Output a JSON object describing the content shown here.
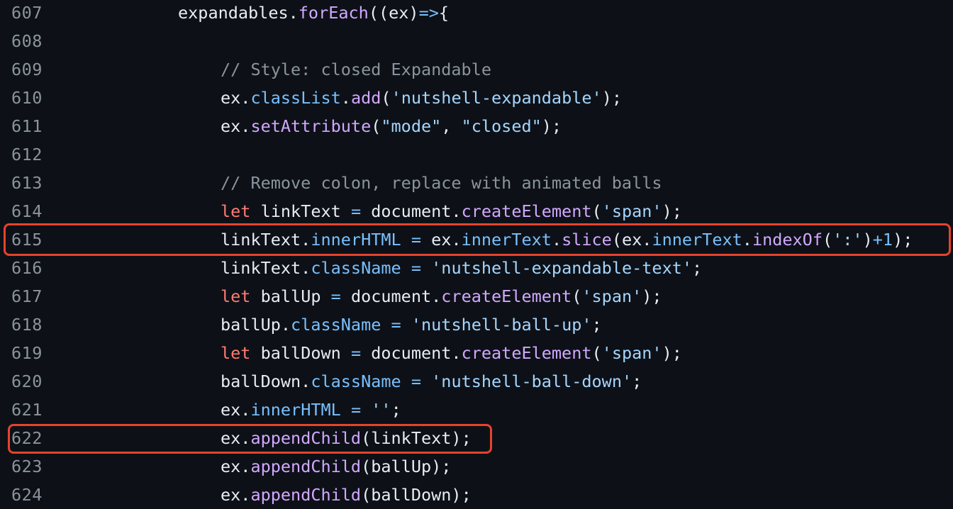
{
  "editor": {
    "lines": [
      {
        "number": "607",
        "indent": 1,
        "tokens": [
          {
            "t": "plain",
            "v": "expandables."
          },
          {
            "t": "fn",
            "v": "forEach"
          },
          {
            "t": "plain",
            "v": "((ex)"
          },
          {
            "t": "op",
            "v": "=>"
          },
          {
            "t": "plain",
            "v": "{"
          }
        ]
      },
      {
        "number": "608",
        "indent": 2,
        "tokens": []
      },
      {
        "number": "609",
        "indent": 2,
        "tokens": [
          {
            "t": "comment",
            "v": "// Style: closed Expandable"
          }
        ]
      },
      {
        "number": "610",
        "indent": 2,
        "tokens": [
          {
            "t": "plain",
            "v": "ex."
          },
          {
            "t": "prop",
            "v": "classList"
          },
          {
            "t": "plain",
            "v": "."
          },
          {
            "t": "fn",
            "v": "add"
          },
          {
            "t": "plain",
            "v": "("
          },
          {
            "t": "str",
            "v": "'nutshell-expandable'"
          },
          {
            "t": "plain",
            "v": ");"
          }
        ]
      },
      {
        "number": "611",
        "indent": 2,
        "tokens": [
          {
            "t": "plain",
            "v": "ex."
          },
          {
            "t": "fn",
            "v": "setAttribute"
          },
          {
            "t": "plain",
            "v": "("
          },
          {
            "t": "str",
            "v": "\"mode\""
          },
          {
            "t": "plain",
            "v": ", "
          },
          {
            "t": "str",
            "v": "\"closed\""
          },
          {
            "t": "plain",
            "v": ");"
          }
        ]
      },
      {
        "number": "612",
        "indent": 2,
        "tokens": []
      },
      {
        "number": "613",
        "indent": 2,
        "tokens": [
          {
            "t": "comment",
            "v": "// Remove colon, replace with animated balls"
          }
        ]
      },
      {
        "number": "614",
        "indent": 2,
        "tokens": [
          {
            "t": "kw",
            "v": "let"
          },
          {
            "t": "plain",
            "v": " linkText "
          },
          {
            "t": "op",
            "v": "="
          },
          {
            "t": "plain",
            "v": " document."
          },
          {
            "t": "fn",
            "v": "createElement"
          },
          {
            "t": "plain",
            "v": "("
          },
          {
            "t": "str",
            "v": "'span'"
          },
          {
            "t": "plain",
            "v": ");"
          }
        ]
      },
      {
        "number": "615",
        "indent": 2,
        "highlighted": true,
        "tokens": [
          {
            "t": "plain",
            "v": "linkText."
          },
          {
            "t": "prop",
            "v": "innerHTML"
          },
          {
            "t": "plain",
            "v": " "
          },
          {
            "t": "op",
            "v": "="
          },
          {
            "t": "plain",
            "v": " ex."
          },
          {
            "t": "prop",
            "v": "innerText"
          },
          {
            "t": "plain",
            "v": "."
          },
          {
            "t": "fn",
            "v": "slice"
          },
          {
            "t": "plain",
            "v": "(ex."
          },
          {
            "t": "prop",
            "v": "innerText"
          },
          {
            "t": "plain",
            "v": "."
          },
          {
            "t": "fn",
            "v": "indexOf"
          },
          {
            "t": "plain",
            "v": "("
          },
          {
            "t": "str",
            "v": "':'"
          },
          {
            "t": "plain",
            "v": ")"
          },
          {
            "t": "op",
            "v": "+"
          },
          {
            "t": "num",
            "v": "1"
          },
          {
            "t": "plain",
            "v": ");"
          }
        ]
      },
      {
        "number": "616",
        "indent": 2,
        "tokens": [
          {
            "t": "plain",
            "v": "linkText."
          },
          {
            "t": "prop",
            "v": "className"
          },
          {
            "t": "plain",
            "v": " "
          },
          {
            "t": "op",
            "v": "="
          },
          {
            "t": "plain",
            "v": " "
          },
          {
            "t": "str",
            "v": "'nutshell-expandable-text'"
          },
          {
            "t": "plain",
            "v": ";"
          }
        ]
      },
      {
        "number": "617",
        "indent": 2,
        "tokens": [
          {
            "t": "kw",
            "v": "let"
          },
          {
            "t": "plain",
            "v": " ballUp "
          },
          {
            "t": "op",
            "v": "="
          },
          {
            "t": "plain",
            "v": " document."
          },
          {
            "t": "fn",
            "v": "createElement"
          },
          {
            "t": "plain",
            "v": "("
          },
          {
            "t": "str",
            "v": "'span'"
          },
          {
            "t": "plain",
            "v": ");"
          }
        ]
      },
      {
        "number": "618",
        "indent": 2,
        "tokens": [
          {
            "t": "plain",
            "v": "ballUp."
          },
          {
            "t": "prop",
            "v": "className"
          },
          {
            "t": "plain",
            "v": " "
          },
          {
            "t": "op",
            "v": "="
          },
          {
            "t": "plain",
            "v": " "
          },
          {
            "t": "str",
            "v": "'nutshell-ball-up'"
          },
          {
            "t": "plain",
            "v": ";"
          }
        ]
      },
      {
        "number": "619",
        "indent": 2,
        "tokens": [
          {
            "t": "kw",
            "v": "let"
          },
          {
            "t": "plain",
            "v": " ballDown "
          },
          {
            "t": "op",
            "v": "="
          },
          {
            "t": "plain",
            "v": " document."
          },
          {
            "t": "fn",
            "v": "createElement"
          },
          {
            "t": "plain",
            "v": "("
          },
          {
            "t": "str",
            "v": "'span'"
          },
          {
            "t": "plain",
            "v": ");"
          }
        ]
      },
      {
        "number": "620",
        "indent": 2,
        "tokens": [
          {
            "t": "plain",
            "v": "ballDown."
          },
          {
            "t": "prop",
            "v": "className"
          },
          {
            "t": "plain",
            "v": " "
          },
          {
            "t": "op",
            "v": "="
          },
          {
            "t": "plain",
            "v": " "
          },
          {
            "t": "str",
            "v": "'nutshell-ball-down'"
          },
          {
            "t": "plain",
            "v": ";"
          }
        ]
      },
      {
        "number": "621",
        "indent": 2,
        "tokens": [
          {
            "t": "plain",
            "v": "ex."
          },
          {
            "t": "prop",
            "v": "innerHTML"
          },
          {
            "t": "plain",
            "v": " "
          },
          {
            "t": "op",
            "v": "="
          },
          {
            "t": "plain",
            "v": " "
          },
          {
            "t": "str",
            "v": "''"
          },
          {
            "t": "plain",
            "v": ";"
          }
        ]
      },
      {
        "number": "622",
        "indent": 2,
        "highlighted": true,
        "tokens": [
          {
            "t": "plain",
            "v": "ex."
          },
          {
            "t": "fn",
            "v": "appendChild"
          },
          {
            "t": "plain",
            "v": "(linkText);"
          }
        ]
      },
      {
        "number": "623",
        "indent": 2,
        "tokens": [
          {
            "t": "plain",
            "v": "ex."
          },
          {
            "t": "fn",
            "v": "appendChild"
          },
          {
            "t": "plain",
            "v": "(ballUp);"
          }
        ]
      },
      {
        "number": "624",
        "indent": 2,
        "tokens": [
          {
            "t": "plain",
            "v": "ex."
          },
          {
            "t": "fn",
            "v": "appendChild"
          },
          {
            "t": "plain",
            "v": "(ballDown);"
          }
        ]
      }
    ]
  },
  "colors": {
    "background": "#0d1117",
    "line_number": "#8b949e",
    "plain": "#e6edf3",
    "function": "#d2a8ff",
    "property": "#79c0ff",
    "string": "#a5d6ff",
    "keyword": "#ff7b72",
    "comment": "#8b949e",
    "highlight_box": "#e5432d"
  }
}
